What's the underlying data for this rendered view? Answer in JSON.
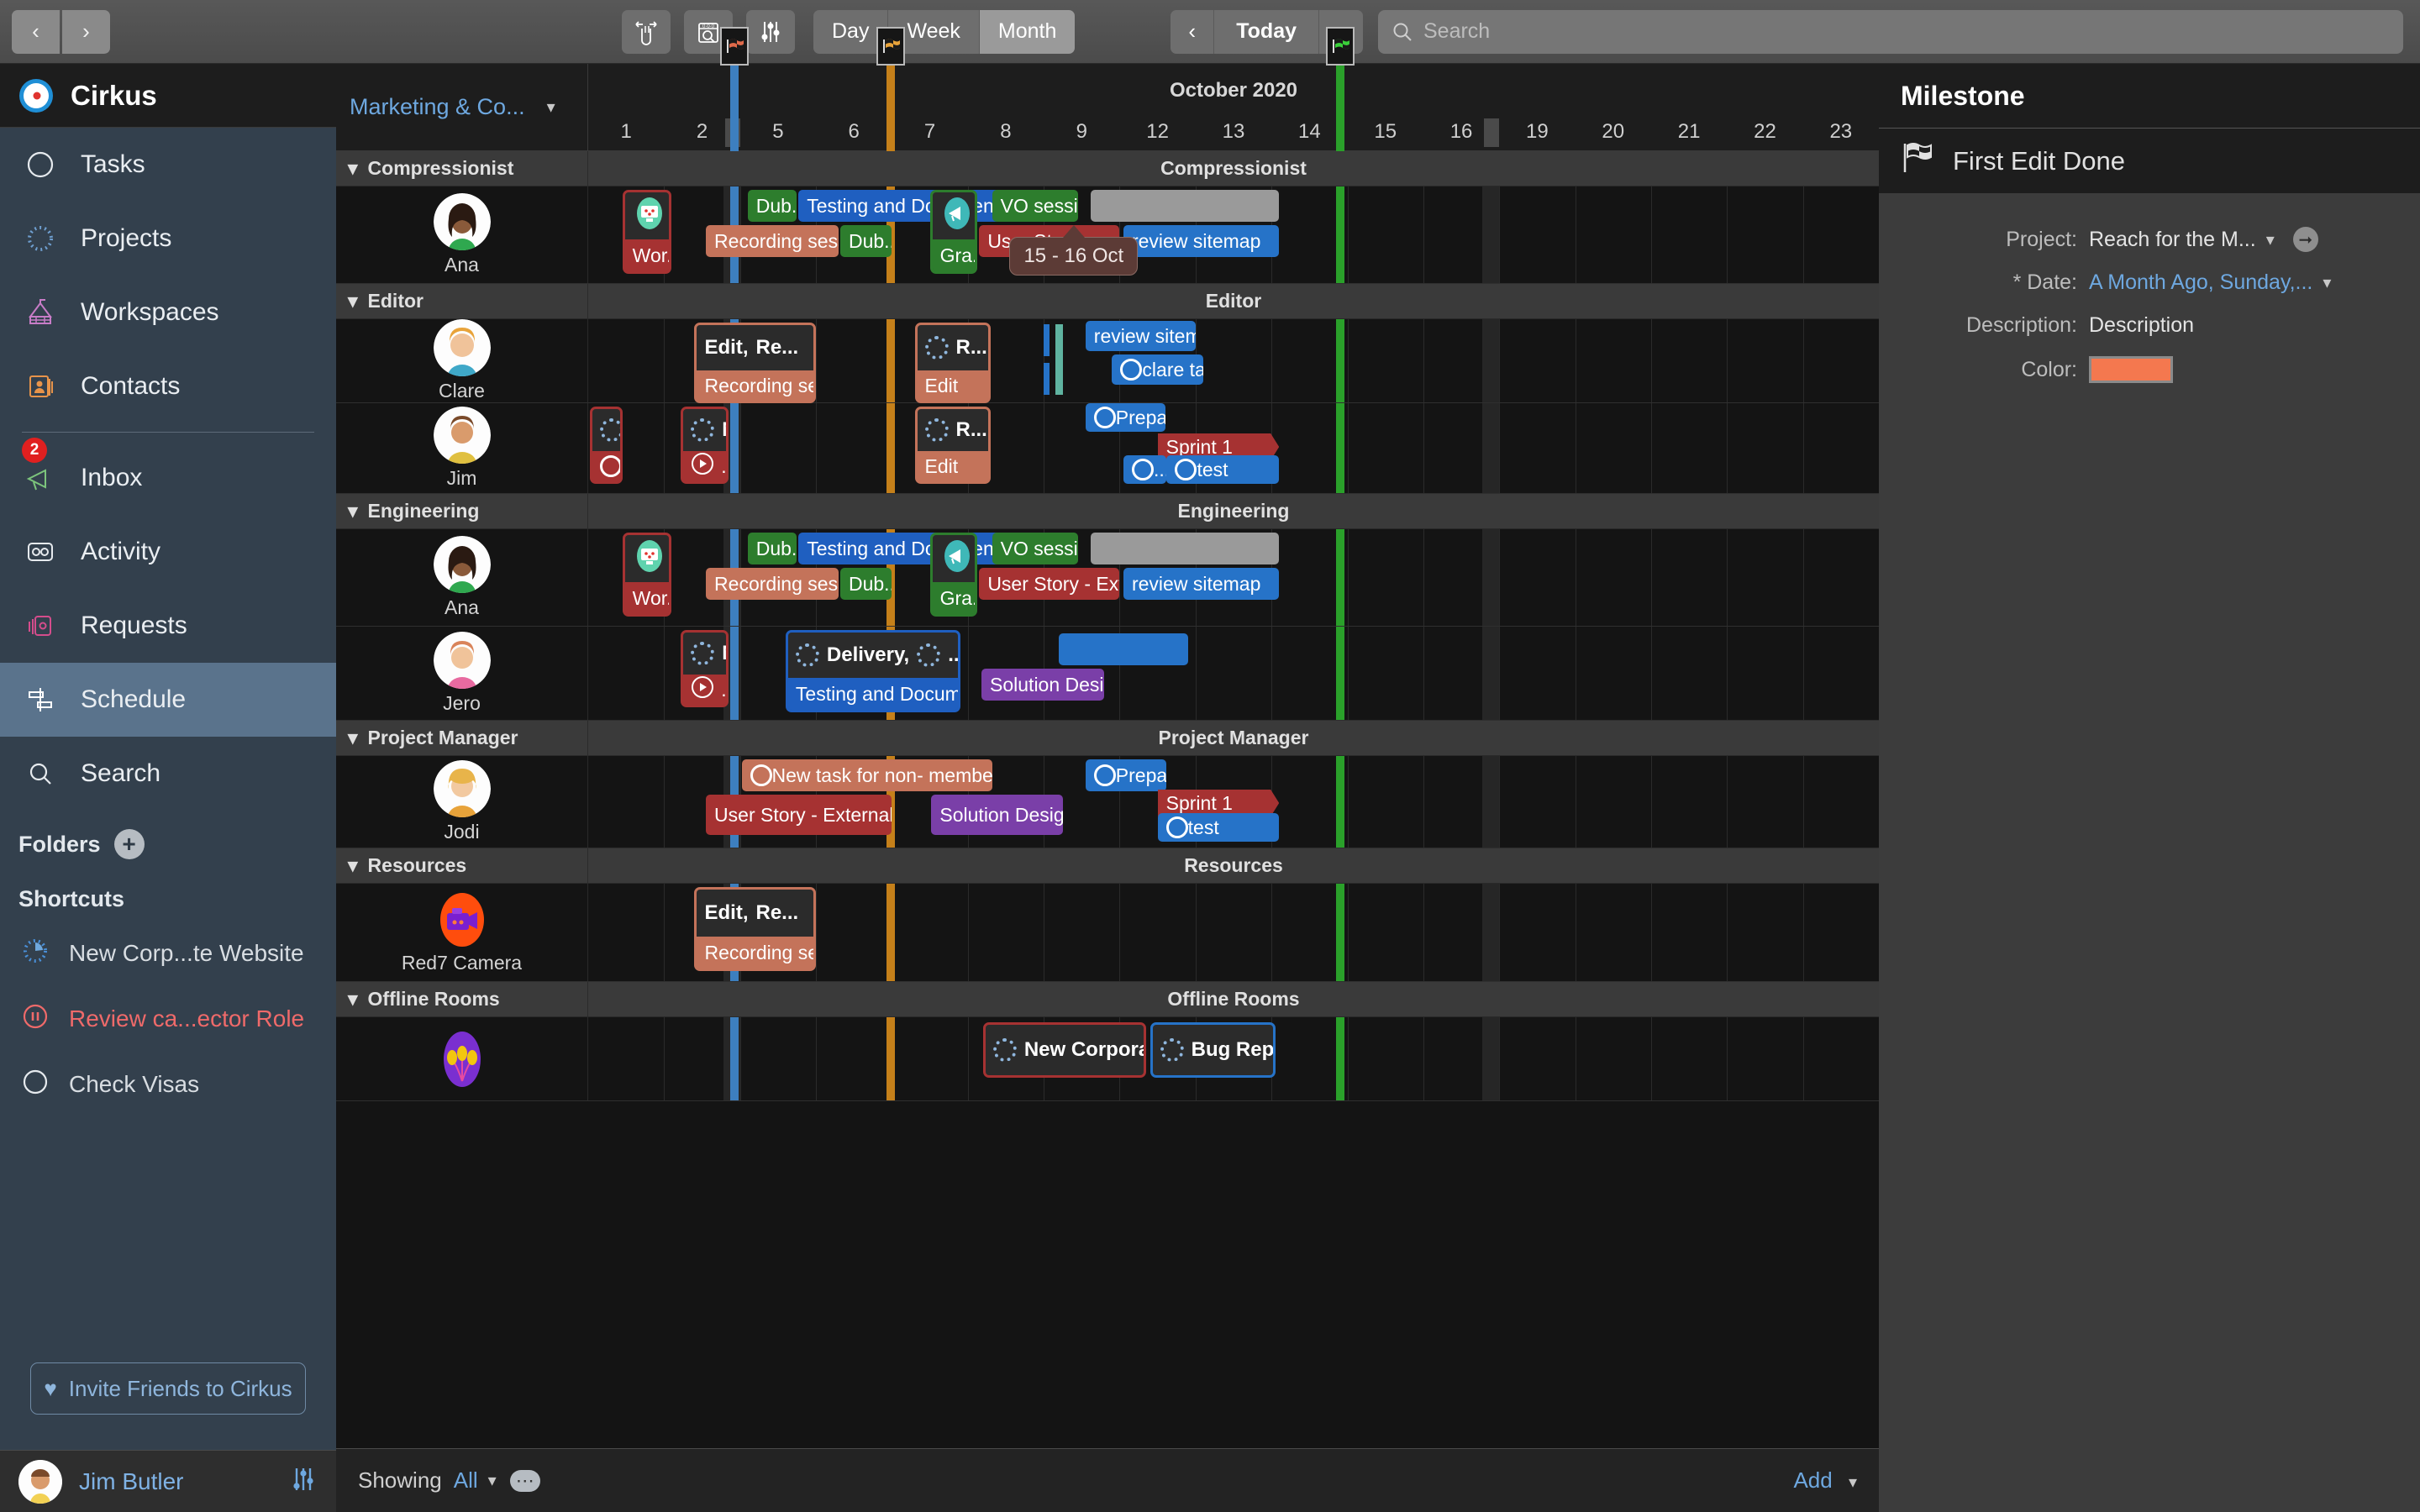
{
  "toolbar": {
    "back_icon": "chevron-left-icon",
    "forward_icon": "chevron-right-icon",
    "hand_tool_label": "hand-tool-icon",
    "find_date_label": "calendar-search-icon",
    "filter_label": "filter-sliders-icon",
    "views": [
      {
        "label": "Day",
        "active": false
      },
      {
        "label": "Week",
        "active": false
      },
      {
        "label": "Month",
        "active": true
      }
    ],
    "today_label": "Today",
    "search_placeholder": "Search",
    "search_value": ""
  },
  "sidebar": {
    "brand": "Cirkus",
    "nav": [
      {
        "label": "Tasks",
        "icon": "circle-icon",
        "selected": true,
        "badge": null
      },
      {
        "label": "Projects",
        "icon": "dotted-circle-icon",
        "selected": false,
        "badge": null
      },
      {
        "label": "Workspaces",
        "icon": "tent-icon",
        "selected": false,
        "badge": null
      },
      {
        "label": "Contacts",
        "icon": "contact-card-icon",
        "selected": false,
        "badge": null
      },
      {
        "label": "Inbox",
        "icon": "megaphone-icon",
        "selected": false,
        "badge": "2"
      },
      {
        "label": "Activity",
        "icon": "activity-icon",
        "selected": false,
        "badge": null
      },
      {
        "label": "Requests",
        "icon": "cards-icon",
        "selected": false,
        "badge": null
      },
      {
        "label": "Schedule",
        "icon": "schedule-icon",
        "selected": true,
        "badge": null
      },
      {
        "label": "Search",
        "icon": "search-icon",
        "selected": false,
        "badge": null
      }
    ],
    "folders_label": "Folders",
    "shortcuts_label": "Shortcuts",
    "shortcuts": [
      {
        "label": "New Corp...te Website",
        "icon": "progress-circle-icon",
        "color": "#d8dde2"
      },
      {
        "label": "Review ca...ector Role",
        "icon": "paused-circle-icon",
        "color": "#ef6a6a"
      },
      {
        "label": "Check Visas",
        "icon": "circle-icon",
        "color": "#d8dde2"
      }
    ],
    "invite_label": "Invite Friends to Cirkus",
    "user_name": "Jim Butler",
    "user_settings_icon": "sliders-icon"
  },
  "schedule": {
    "project_selector": "Marketing & Co...",
    "month_label": "October 2020",
    "days": [
      "1",
      "2",
      "5",
      "6",
      "7",
      "8",
      "9",
      "12",
      "13",
      "14",
      "15",
      "16",
      "19",
      "20",
      "21",
      "22",
      "23"
    ],
    "tooltip": "15 - 16 Oct",
    "milestones": [
      {
        "color": "#3d7fbf",
        "flag": "blue"
      },
      {
        "color": "#c5801a",
        "flag": "orange"
      },
      {
        "color": "#2aa02a",
        "flag": "green"
      }
    ],
    "groups": [
      {
        "name": "Compressionist",
        "resources": [
          {
            "name": "Ana",
            "avatar": "ana-avatar",
            "bars": [
              {
                "label": "Wor...",
                "color": "#a63232",
                "row": 1,
                "card": true,
                "card_title": "",
                "icons": [
                  "screen-icon",
                  "dotted-circle-icon"
                ]
              },
              {
                "label": "Dub...",
                "color": "#2d7d2d",
                "row": 0
              },
              {
                "label": "Testing and Document...",
                "color": "#1f5fc0",
                "row": 0
              },
              {
                "label": "Recording session",
                "color": "#c4735a",
                "row": 1
              },
              {
                "label": "Dub...",
                "color": "#2d7d2d",
                "row": 1
              },
              {
                "label": "Gra...",
                "color": "#2d7d2d",
                "row": 1,
                "card": true,
                "icons": [
                  "megaphone-icon",
                  "dotted-circle-icon"
                ]
              },
              {
                "label": "VO session",
                "color": "#2d7d2d",
                "row": 0
              },
              {
                "label": "User St",
                "color": "#a63232",
                "row": 1
              },
              {
                "label": "review sitemap",
                "color": "#2673c8",
                "row": 1
              },
              {
                "label": "",
                "color": "#9a9a9a",
                "row": 0
              }
            ]
          }
        ]
      },
      {
        "name": "Editor",
        "resources": [
          {
            "name": "Clare",
            "avatar": "clare-avatar",
            "bars": [
              {
                "label": "Edit,",
                "label2": "Re...",
                "color": "#c4735a",
                "row": 0,
                "card": true
              },
              {
                "label": "Recording session",
                "color": "#c4735a",
                "row": 1
              },
              {
                "label": "R...",
                "color": "#c4735a",
                "row": 0,
                "card": true
              },
              {
                "label": "Edit",
                "color": "#c4735a",
                "row": 1
              },
              {
                "label": "review sitemap",
                "color": "#2673c8",
                "row": 0
              },
              {
                "label": "clare ta...",
                "color": "#2673c8",
                "row": 1
              }
            ]
          },
          {
            "name": "Jim",
            "avatar": "jim-avatar",
            "bars": [
              {
                "label": "",
                "color": "#a63232",
                "row": 0,
                "card": true
              },
              {
                "label": "N",
                "color": "#a63232",
                "row": 0,
                "card": true
              },
              {
                "label": "R...",
                "color": "#c4735a",
                "row": 0,
                "card": true
              },
              {
                "label": "Edit",
                "color": "#c4735a",
                "row": 1
              },
              {
                "label": "Prepare Finals",
                "color": "#2673c8",
                "row": 0
              },
              {
                "label": "Sprint 1",
                "color": "#a63232",
                "row": 1
              },
              {
                "label": "...",
                "color": "#2673c8",
                "row": 2
              },
              {
                "label": "test",
                "color": "#2673c8",
                "row": 2
              }
            ]
          }
        ]
      },
      {
        "name": "Engineering",
        "resources": [
          {
            "name": "Ana",
            "avatar": "ana-avatar",
            "bars": [
              {
                "label": "Wor...",
                "color": "#a63232",
                "row": 1,
                "card": true
              },
              {
                "label": "Dub...",
                "color": "#2d7d2d",
                "row": 0
              },
              {
                "label": "Testing and Document...",
                "color": "#1f5fc0",
                "row": 0
              },
              {
                "label": "Recording session",
                "color": "#c4735a",
                "row": 1
              },
              {
                "label": "Dub...",
                "color": "#2d7d2d",
                "row": 1
              },
              {
                "label": "Gra...",
                "color": "#2d7d2d",
                "row": 1,
                "card": true
              },
              {
                "label": "VO session",
                "color": "#2d7d2d",
                "row": 0
              },
              {
                "label": "User Story - External",
                "color": "#a63232",
                "row": 1
              },
              {
                "label": "review sitemap",
                "color": "#2673c8",
                "row": 1
              },
              {
                "label": "",
                "color": "#9a9a9a",
                "row": 0
              }
            ]
          },
          {
            "name": "Jero",
            "avatar": "jero-avatar",
            "bars": [
              {
                "label": "N",
                "color": "#a63232",
                "row": 0,
                "card": true
              },
              {
                "label": "Delivery,",
                "color": "#1f5fc0",
                "row": 0,
                "card": true
              },
              {
                "label": "Testing and Document...",
                "color": "#1f5fc0",
                "row": 1
              },
              {
                "label": "Solution Design",
                "color": "#7a3fa8",
                "row": 1
              },
              {
                "label": "",
                "color": "#2673c8",
                "row": 0
              }
            ]
          }
        ]
      },
      {
        "name": "Project Manager",
        "resources": [
          {
            "name": "Jodi",
            "avatar": "jodi-avatar",
            "bars": [
              {
                "label": "New task for non- member",
                "color": "#c4735a",
                "row": 0
              },
              {
                "label": "User Story - External",
                "color": "#a63232",
                "row": 1
              },
              {
                "label": "Solution Design",
                "color": "#7a3fa8",
                "row": 1
              },
              {
                "label": "Prepare Finals",
                "color": "#2673c8",
                "row": 0
              },
              {
                "label": "Sprint 1",
                "color": "#a63232",
                "row": 1
              },
              {
                "label": "test",
                "color": "#2673c8",
                "row": 2
              }
            ]
          }
        ]
      },
      {
        "name": "Resources",
        "resources": [
          {
            "name": "Red7 Camera",
            "avatar": "camera-avatar",
            "bars": [
              {
                "label": "Edit,",
                "label2": "Re...",
                "color": "#c4735a",
                "row": 0,
                "card": true
              },
              {
                "label": "Recording session",
                "color": "#c4735a",
                "row": 1
              }
            ]
          }
        ]
      },
      {
        "name": "Offline Rooms",
        "resources": [
          {
            "name": "",
            "avatar": "flowers-avatar",
            "bars": [
              {
                "label": "New Corporate We...",
                "color": "#a63232",
                "row": 0,
                "card": true
              },
              {
                "label": "Bug Reports,",
                "color": "#2673c8",
                "row": 0,
                "card": true
              }
            ]
          }
        ]
      }
    ],
    "footer": {
      "showing_label": "Showing",
      "showing_value": "All",
      "more_icon": "ellipsis-icon",
      "add_label": "Add"
    }
  },
  "inspector": {
    "title": "Milestone",
    "name": "First Edit Done",
    "name_icon": "checkered-flag-icon",
    "fields": [
      {
        "label": "Project:",
        "value": "Reach for the M...",
        "link": false,
        "chevron": true,
        "arrow": true
      },
      {
        "label": "* Date:",
        "value": "A Month Ago, Sunday,...",
        "link": true,
        "chevron": true,
        "arrow": false
      },
      {
        "label": "Description:",
        "value": "Description",
        "link": false,
        "chevron": false,
        "arrow": false
      }
    ],
    "color_label": "Color:",
    "color_value": "#f4784f"
  }
}
